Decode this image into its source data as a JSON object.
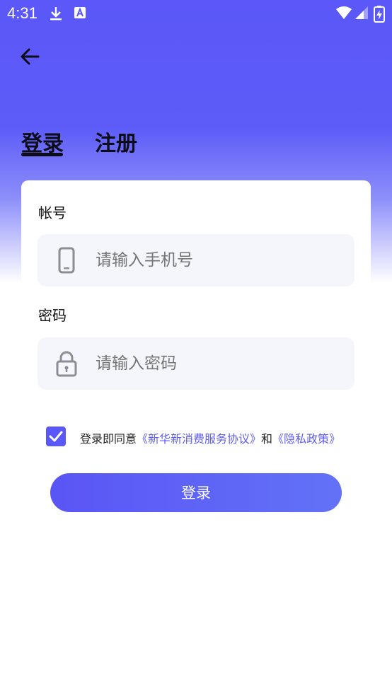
{
  "status_bar": {
    "time": "4:31"
  },
  "tabs": {
    "login": "登录",
    "register": "注册"
  },
  "form": {
    "account_label": "帐号",
    "phone_placeholder": "请输入手机号",
    "password_label": "密码",
    "password_placeholder": "请输入密码"
  },
  "agreement": {
    "prefix": "登录即同意",
    "service_link": "《新华新消费服务协议》",
    "joiner": "和",
    "privacy_link": "《隐私政策》",
    "checked": true
  },
  "login_button": "登录",
  "colors": {
    "accent": "#5a58f6",
    "link": "#5d5bf3",
    "field_bg": "#f5f6fb"
  }
}
